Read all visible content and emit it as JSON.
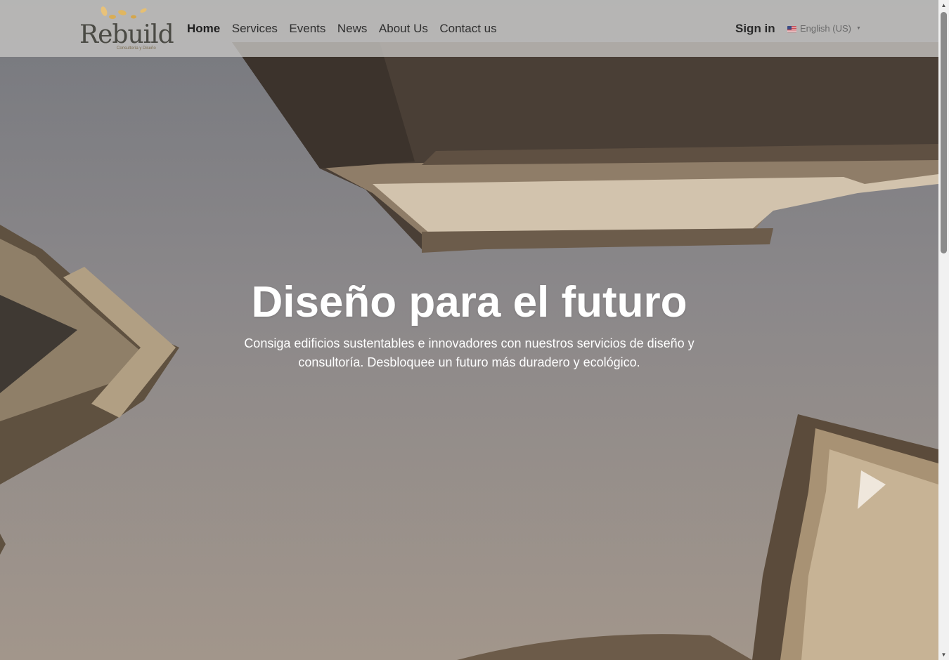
{
  "header": {
    "logo": {
      "word": "Rebuild",
      "tagline": "Consultoría y Diseño"
    },
    "nav": [
      {
        "label": "Home",
        "active": true
      },
      {
        "label": "Services",
        "active": false
      },
      {
        "label": "Events",
        "active": false
      },
      {
        "label": "News",
        "active": false
      },
      {
        "label": "About Us",
        "active": false
      },
      {
        "label": "Contact us",
        "active": false
      }
    ],
    "signin_label": "Sign in",
    "language": {
      "label": "English (US)",
      "icon": "us-flag-icon"
    }
  },
  "hero": {
    "title": "Diseño para el futuro",
    "subtitle": "Consiga edificios sustentables e innovadores con nuestros servicios de diseño y consultoría. Desbloquee un futuro más duradero y ecológico."
  },
  "colors": {
    "header_bg": "#c6c4c2",
    "text_dark": "#2f2f2f",
    "hero_text": "#ffffff",
    "logo_gold": "#d9ad55"
  }
}
